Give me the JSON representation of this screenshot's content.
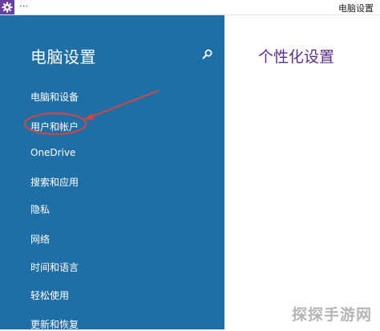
{
  "window": {
    "title": "电脑设置",
    "menu_glyph": "⋯",
    "app_icon": "gear-icon"
  },
  "sidebar": {
    "title": "电脑设置",
    "search_icon": "search-icon",
    "items": [
      {
        "label": "电脑和设备"
      },
      {
        "label": "用户和帐户"
      },
      {
        "label": "OneDrive"
      },
      {
        "label": "搜索和应用"
      },
      {
        "label": "隐私"
      },
      {
        "label": "网络"
      },
      {
        "label": "时间和语言"
      },
      {
        "label": "轻松使用"
      },
      {
        "label": "更新和恢复"
      }
    ]
  },
  "main": {
    "title": "个性化设置"
  },
  "watermark": {
    "text": "探探手游网"
  },
  "colors": {
    "sidebar_bg": "#1e6fa8",
    "accent_purple": "#5b2d8f",
    "annotation_red": "#d9443a"
  }
}
